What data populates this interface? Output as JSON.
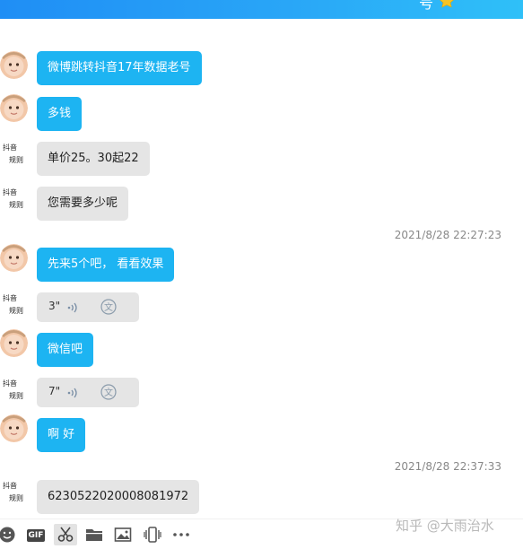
{
  "header": {
    "title_fragment": "号"
  },
  "messages": [
    {
      "text": "微博跳转抖音17年数据老号"
    },
    {
      "text": "多钱"
    },
    {
      "text": "单价25。30起22"
    },
    {
      "text": "您需要多少呢"
    },
    {
      "text": "2021/8/28 22:27:23"
    },
    {
      "text": "先来5个吧， 看看效果"
    },
    {
      "duration": "3\""
    },
    {
      "text": "微信吧"
    },
    {
      "duration": "7\""
    },
    {
      "text": "啊  好"
    },
    {
      "text": "2021/8/28 22:37:33"
    },
    {
      "text": "6230522020008081972"
    }
  ],
  "avatar_text": {
    "line1": "抖音",
    "line2": "规则"
  },
  "watermark": "知乎 @大雨治水",
  "colors": {
    "bubble_blue": "#1db4f2",
    "bubble_gray": "#e5e5e5",
    "header": "#29a6f7"
  },
  "toolbar_icons": [
    "emoji-icon",
    "gif-icon",
    "scissors-icon",
    "folder-icon",
    "image-icon",
    "shake-icon",
    "more-icon"
  ]
}
